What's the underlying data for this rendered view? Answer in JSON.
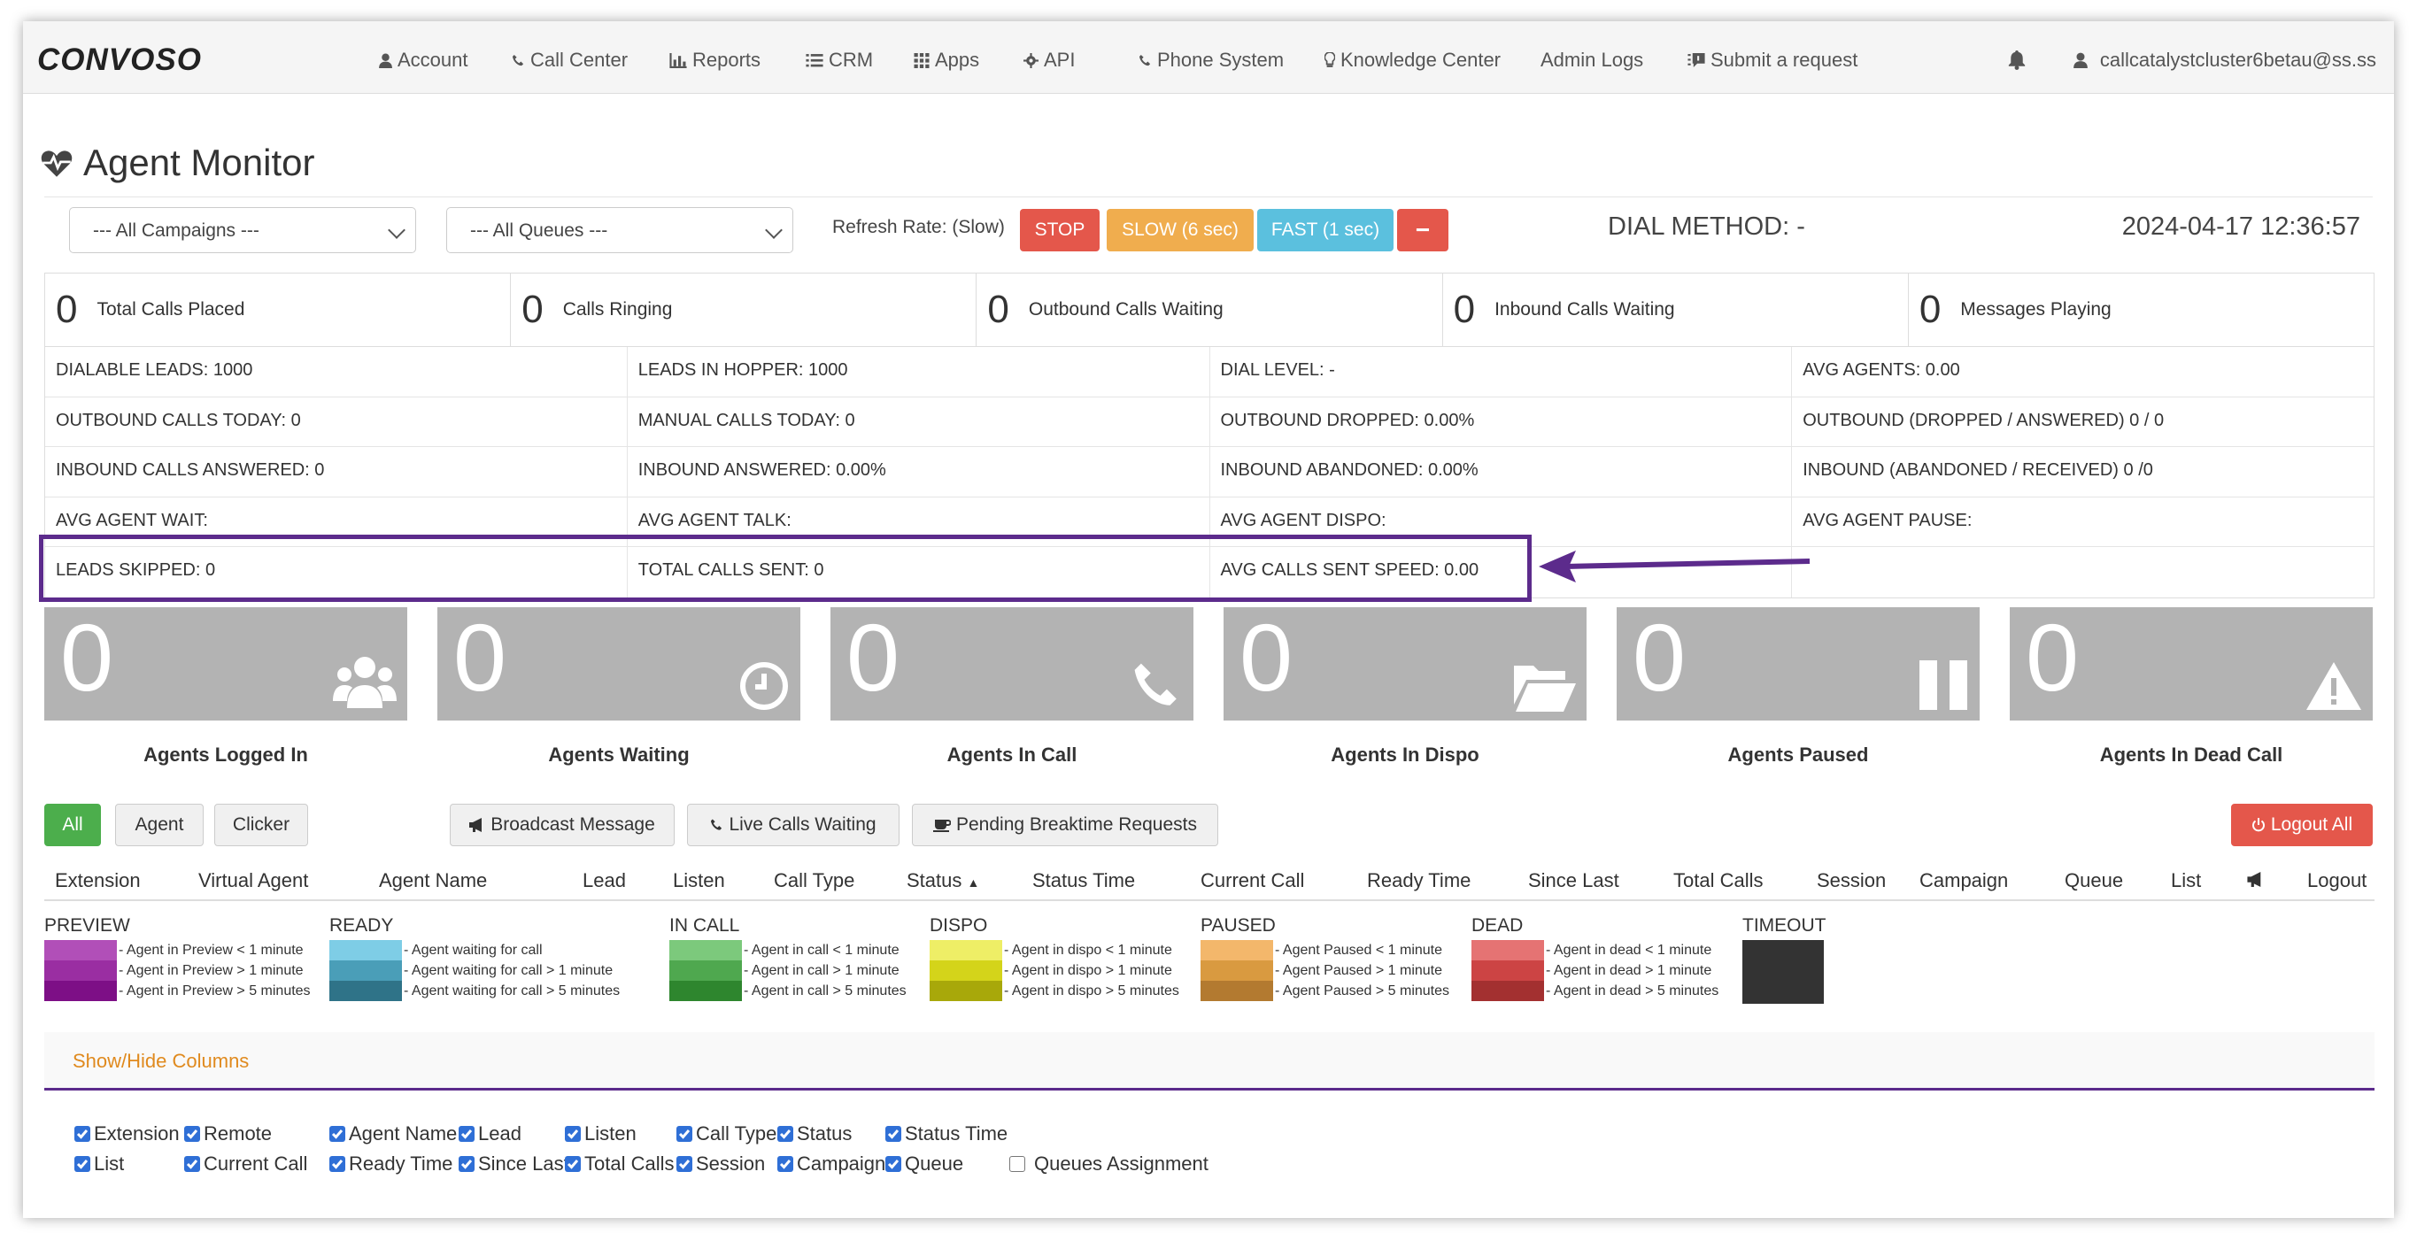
{
  "brand": "CONVOSO",
  "nav": {
    "items": [
      "Account",
      "Call Center",
      "Reports",
      "CRM",
      "Apps",
      "API",
      "Phone System",
      "Knowledge Center",
      "Admin Logs",
      "Submit a request"
    ],
    "user_email": "callcatalystcluster6betau@ss.ss"
  },
  "page": {
    "title": "Agent Monitor"
  },
  "filters": {
    "campaign": "--- All Campaigns ---",
    "queue": "--- All Queues ---",
    "refresh_label": "Refresh Rate: (Slow)",
    "stop": "STOP",
    "slow": "SLOW (6 sec)",
    "fast": "FAST (1 sec)",
    "minus": "−",
    "dial_method": "DIAL METHOD: -",
    "datetime": "2024-04-17 12:36:57"
  },
  "counters": [
    {
      "value": "0",
      "label": "Total Calls Placed"
    },
    {
      "value": "0",
      "label": "Calls Ringing"
    },
    {
      "value": "0",
      "label": "Outbound Calls Waiting"
    },
    {
      "value": "0",
      "label": "Inbound Calls Waiting"
    },
    {
      "value": "0",
      "label": "Messages Playing"
    }
  ],
  "stats": [
    [
      "DIALABLE LEADS: 1000",
      "LEADS IN HOPPER: 1000",
      "DIAL LEVEL: -",
      "AVG AGENTS: 0.00"
    ],
    [
      "OUTBOUND CALLS TODAY: 0",
      "MANUAL CALLS TODAY: 0",
      "OUTBOUND DROPPED: 0.00%",
      "OUTBOUND (DROPPED / ANSWERED) 0 / 0"
    ],
    [
      "INBOUND CALLS ANSWERED: 0",
      "INBOUND ANSWERED: 0.00%",
      "INBOUND ABANDONED: 0.00%",
      "INBOUND (ABANDONED / RECEIVED) 0 /0"
    ],
    [
      "AVG AGENT WAIT:",
      "AVG AGENT TALK:",
      "AVG AGENT DISPO:",
      "AVG AGENT PAUSE:"
    ],
    [
      "LEADS SKIPPED: 0",
      "TOTAL CALLS SENT: 0",
      "AVG CALLS SENT SPEED: 0.00",
      ""
    ]
  ],
  "tiles": [
    {
      "value": "0",
      "label": "Agents Logged In",
      "icon": "users-icon"
    },
    {
      "value": "0",
      "label": "Agents Waiting",
      "icon": "clock-icon"
    },
    {
      "value": "0",
      "label": "Agents In Call",
      "icon": "phone-icon"
    },
    {
      "value": "0",
      "label": "Agents In Dispo",
      "icon": "folder-open-icon"
    },
    {
      "value": "0",
      "label": "Agents Paused",
      "icon": "pause-icon"
    },
    {
      "value": "0",
      "label": "Agents In Dead Call",
      "icon": "warning-icon"
    }
  ],
  "filter_buttons": {
    "all": "All",
    "agent": "Agent",
    "clicker": "Clicker",
    "broadcast": "Broadcast Message",
    "live_calls": "Live Calls Waiting",
    "pending_break": "Pending Breaktime Requests",
    "logout_all": "Logout All"
  },
  "table_headers": [
    "Extension",
    "Virtual Agent",
    "Agent Name",
    "Lead",
    "Listen",
    "Call Type",
    "Status",
    "Status Time",
    "Current Call",
    "Ready Time",
    "Since Last",
    "Total Calls",
    "Session",
    "Campaign",
    "Queue",
    "List",
    "",
    "Logout"
  ],
  "legend": [
    {
      "title": "PREVIEW",
      "rows": [
        {
          "color": "#b14fb8",
          "text": "- Agent in Preview < 1 minute"
        },
        {
          "color": "#9a2ea2",
          "text": "- Agent in Preview > 1 minute"
        },
        {
          "color": "#7d0f86",
          "text": "- Agent in Preview > 5 minutes"
        }
      ]
    },
    {
      "title": "READY",
      "rows": [
        {
          "color": "#7ecde6",
          "text": "- Agent waiting for call"
        },
        {
          "color": "#4a9eb8",
          "text": "- Agent waiting for call > 1 minute"
        },
        {
          "color": "#2f7388",
          "text": "- Agent waiting for call > 5 minutes"
        }
      ]
    },
    {
      "title": "IN CALL",
      "rows": [
        {
          "color": "#7cc97c",
          "text": "- Agent in call < 1 minute"
        },
        {
          "color": "#4fa84f",
          "text": "- Agent in call > 1 minute"
        },
        {
          "color": "#2e862e",
          "text": "- Agent in call > 5 minutes"
        }
      ]
    },
    {
      "title": "DISPO",
      "rows": [
        {
          "color": "#eeee66",
          "text": "- Agent in dispo < 1 minute"
        },
        {
          "color": "#d4d41a",
          "text": "- Agent in dispo > 1 minute"
        },
        {
          "color": "#a8a80a",
          "text": "- Agent in dispo > 5 minutes"
        }
      ]
    },
    {
      "title": "PAUSED",
      "rows": [
        {
          "color": "#f3b76b",
          "text": "- Agent Paused < 1 minute"
        },
        {
          "color": "#d99a40",
          "text": "- Agent Paused > 1 minute"
        },
        {
          "color": "#b37a30",
          "text": "- Agent Paused > 5 minutes"
        }
      ]
    },
    {
      "title": "DEAD",
      "rows": [
        {
          "color": "#e57373",
          "text": "- Agent in dead < 1 minute"
        },
        {
          "color": "#cc4444",
          "text": "- Agent in dead > 1 minute"
        },
        {
          "color": "#a33030",
          "text": "- Agent in dead > 5 minutes"
        }
      ]
    },
    {
      "title": "TIMEOUT",
      "rows": []
    }
  ],
  "timeout_color": "#333333",
  "show_hide": "Show/Hide Columns",
  "column_toggles": [
    {
      "label": "Extension",
      "checked": true
    },
    {
      "label": "Remote",
      "checked": true
    },
    {
      "label": "Agent Name",
      "checked": true
    },
    {
      "label": "Lead",
      "checked": true
    },
    {
      "label": "Listen",
      "checked": true
    },
    {
      "label": "Call Type",
      "checked": true
    },
    {
      "label": "Status",
      "checked": true
    },
    {
      "label": "Status Time",
      "checked": true
    },
    {
      "label": "List",
      "checked": true
    },
    {
      "label": "Current Call",
      "checked": true
    },
    {
      "label": "Ready Time",
      "checked": true
    },
    {
      "label": "Since Last",
      "checked": true
    },
    {
      "label": "Total Calls",
      "checked": true
    },
    {
      "label": "Session",
      "checked": true
    },
    {
      "label": "Campaign",
      "checked": true
    },
    {
      "label": "Queue",
      "checked": true
    },
    {
      "label": "Queues Assignment",
      "checked": false
    }
  ],
  "colors": {
    "stop": "#e4574b",
    "slow": "#f0ad4e",
    "fast": "#5bc0de",
    "all_btn": "#4cae4c",
    "logout": "#e4574b",
    "highlight": "#5c2b8c",
    "tile": "#b3b3b3"
  }
}
